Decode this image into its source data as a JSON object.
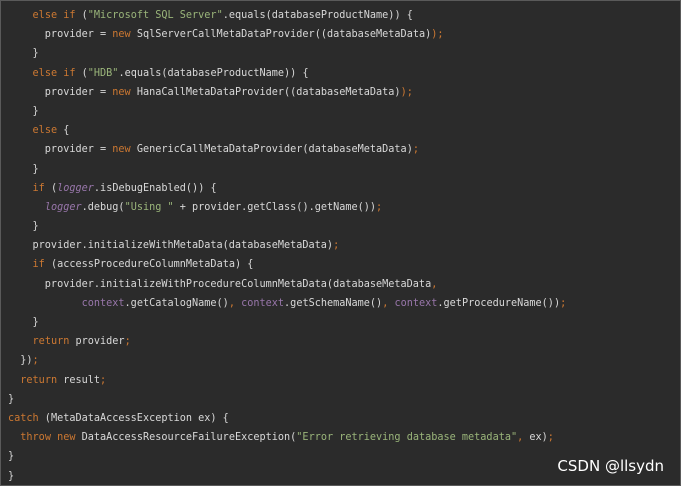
{
  "code_lines": [
    [
      {
        "t": "    ",
        "c": "plain"
      },
      {
        "t": "else if",
        "c": "kw"
      },
      {
        "t": " (",
        "c": "plain"
      },
      {
        "t": "\"Microsoft SQL Server\"",
        "c": "str"
      },
      {
        "t": ".equals(databaseProductName)) {",
        "c": "plain"
      }
    ],
    [
      {
        "t": "      provider = ",
        "c": "plain"
      },
      {
        "t": "new",
        "c": "kw"
      },
      {
        "t": " SqlServerCallMetaDataProvider((databaseMetaData)",
        "c": "plain"
      },
      {
        "t": ");",
        "c": "kw"
      }
    ],
    [
      {
        "t": "    }",
        "c": "plain"
      }
    ],
    [
      {
        "t": "    ",
        "c": "plain"
      },
      {
        "t": "else if",
        "c": "kw"
      },
      {
        "t": " (",
        "c": "plain"
      },
      {
        "t": "\"HDB\"",
        "c": "str"
      },
      {
        "t": ".equals(databaseProductName)) {",
        "c": "plain"
      }
    ],
    [
      {
        "t": "      provider = ",
        "c": "plain"
      },
      {
        "t": "new",
        "c": "kw"
      },
      {
        "t": " HanaCallMetaDataProvider((databaseMetaData)",
        "c": "plain"
      },
      {
        "t": ");",
        "c": "kw"
      }
    ],
    [
      {
        "t": "    }",
        "c": "plain"
      }
    ],
    [
      {
        "t": "    ",
        "c": "plain"
      },
      {
        "t": "else",
        "c": "kw"
      },
      {
        "t": " {",
        "c": "plain"
      }
    ],
    [
      {
        "t": "      provider = ",
        "c": "plain"
      },
      {
        "t": "new",
        "c": "kw"
      },
      {
        "t": " GenericCallMetaDataProvider(databaseMetaData)",
        "c": "plain"
      },
      {
        "t": ";",
        "c": "kw"
      }
    ],
    [
      {
        "t": "    }",
        "c": "plain"
      }
    ],
    [
      {
        "t": "    ",
        "c": "plain"
      },
      {
        "t": "if",
        "c": "kw"
      },
      {
        "t": " (",
        "c": "plain"
      },
      {
        "t": "logger",
        "c": "fld ital"
      },
      {
        "t": ".isDebugEnabled()) {",
        "c": "plain"
      }
    ],
    [
      {
        "t": "      ",
        "c": "plain"
      },
      {
        "t": "logger",
        "c": "fld ital"
      },
      {
        "t": ".debug(",
        "c": "plain"
      },
      {
        "t": "\"Using \"",
        "c": "str"
      },
      {
        "t": " + provider.getClass().getName())",
        "c": "plain"
      },
      {
        "t": ";",
        "c": "kw"
      }
    ],
    [
      {
        "t": "    }",
        "c": "plain"
      }
    ],
    [
      {
        "t": "    provider.initializeWithMetaData(databaseMetaData)",
        "c": "plain"
      },
      {
        "t": ";",
        "c": "kw"
      }
    ],
    [
      {
        "t": "    ",
        "c": "plain"
      },
      {
        "t": "if",
        "c": "kw"
      },
      {
        "t": " (accessProcedureColumnMetaData) {",
        "c": "plain"
      }
    ],
    [
      {
        "t": "      provider.initializeWithProcedureColumnMetaData(databaseMetaData",
        "c": "plain"
      },
      {
        "t": ",",
        "c": "kw"
      }
    ],
    [
      {
        "t": "            ",
        "c": "plain"
      },
      {
        "t": "context",
        "c": "fld"
      },
      {
        "t": ".getCatalogName()",
        "c": "plain"
      },
      {
        "t": ", ",
        "c": "kw"
      },
      {
        "t": "context",
        "c": "fld"
      },
      {
        "t": ".getSchemaName()",
        "c": "plain"
      },
      {
        "t": ", ",
        "c": "kw"
      },
      {
        "t": "context",
        "c": "fld"
      },
      {
        "t": ".getProcedureName())",
        "c": "plain"
      },
      {
        "t": ";",
        "c": "kw"
      }
    ],
    [
      {
        "t": "    }",
        "c": "plain"
      }
    ],
    [
      {
        "t": "    ",
        "c": "plain"
      },
      {
        "t": "return",
        "c": "kw"
      },
      {
        "t": " provider",
        "c": "plain"
      },
      {
        "t": ";",
        "c": "kw"
      }
    ],
    [
      {
        "t": "  })",
        "c": "plain"
      },
      {
        "t": ";",
        "c": "kw"
      }
    ],
    [
      {
        "t": "  ",
        "c": "plain"
      },
      {
        "t": "return",
        "c": "kw"
      },
      {
        "t": " result",
        "c": "plain"
      },
      {
        "t": ";",
        "c": "kw"
      }
    ],
    [
      {
        "t": "}",
        "c": "plain"
      }
    ],
    [
      {
        "t": "catch",
        "c": "kw"
      },
      {
        "t": " (MetaDataAccessException ex) {",
        "c": "plain"
      }
    ],
    [
      {
        "t": "  ",
        "c": "plain"
      },
      {
        "t": "throw new",
        "c": "kw"
      },
      {
        "t": " DataAccessResourceFailureException(",
        "c": "plain"
      },
      {
        "t": "\"Error retrieving database metadata\"",
        "c": "str"
      },
      {
        "t": ", ",
        "c": "kw"
      },
      {
        "t": "ex)",
        "c": "plain"
      },
      {
        "t": ";",
        "c": "kw"
      }
    ],
    [
      {
        "t": "}",
        "c": "plain"
      }
    ],
    [
      {
        "t": "}",
        "c": "plain"
      }
    ]
  ],
  "watermark": "CSDN @llsydn"
}
